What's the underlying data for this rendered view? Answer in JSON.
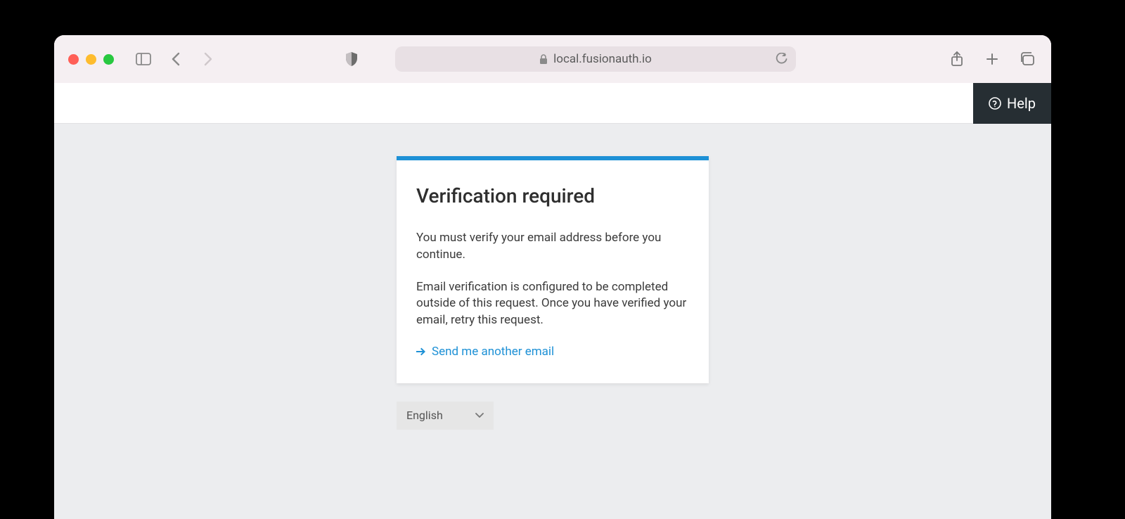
{
  "browser": {
    "url": "local.fusionauth.io"
  },
  "topbar": {
    "help_label": "Help"
  },
  "card": {
    "title": "Verification required",
    "paragraph1": "You must verify your email address before you continue.",
    "paragraph2": "Email verification is configured to be completed outside of this request. Once you have verified your email, retry this request.",
    "resend_label": "Send me another email"
  },
  "language": {
    "selected": "English"
  }
}
